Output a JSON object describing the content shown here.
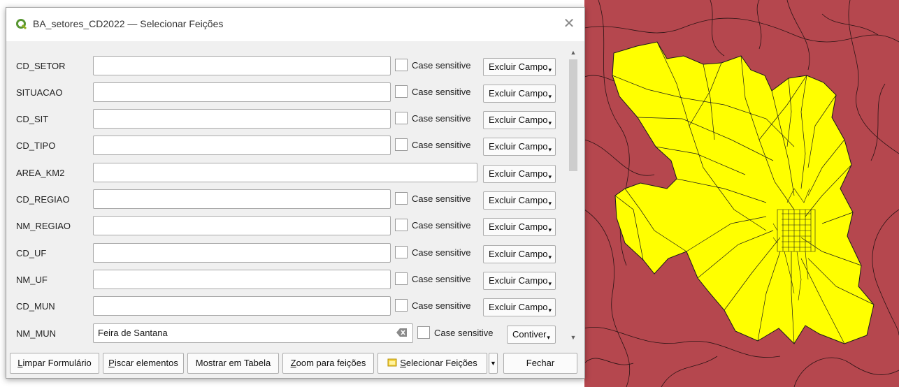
{
  "window": {
    "title": "BA_setores_CD2022 — Selecionar Feições",
    "close_glyph": "✕"
  },
  "fields": [
    {
      "label": "CD_SETOR",
      "value": "",
      "case_sensitive": true,
      "operator": "Excluir Campo"
    },
    {
      "label": "SITUACAO",
      "value": "",
      "case_sensitive": true,
      "operator": "Excluir Campo"
    },
    {
      "label": "CD_SIT",
      "value": "",
      "case_sensitive": true,
      "operator": "Excluir Campo"
    },
    {
      "label": "CD_TIPO",
      "value": "",
      "case_sensitive": true,
      "operator": "Excluir Campo"
    },
    {
      "label": "AREA_KM2",
      "value": "",
      "case_sensitive": false,
      "operator": "Excluir Campo"
    },
    {
      "label": "CD_REGIAO",
      "value": "",
      "case_sensitive": true,
      "operator": "Excluir Campo"
    },
    {
      "label": "NM_REGIAO",
      "value": "",
      "case_sensitive": true,
      "operator": "Excluir Campo"
    },
    {
      "label": "CD_UF",
      "value": "",
      "case_sensitive": true,
      "operator": "Excluir Campo"
    },
    {
      "label": "NM_UF",
      "value": "",
      "case_sensitive": true,
      "operator": "Excluir Campo"
    },
    {
      "label": "CD_MUN",
      "value": "",
      "case_sensitive": true,
      "operator": "Excluir Campo"
    },
    {
      "label": "NM_MUN",
      "value": "Feira de Santana",
      "case_sensitive": true,
      "operator": "Contiver"
    }
  ],
  "case_sensitive_label": "Case sensitive",
  "buttons": {
    "clear_form": {
      "underline": "L",
      "rest": "impar Formulário"
    },
    "flash": {
      "underline": "P",
      "rest": "iscar elementos"
    },
    "show_table": "Mostrar em Tabela",
    "zoom": {
      "underline": "Z",
      "rest": "oom para feições"
    },
    "select": {
      "underline": "S",
      "rest": "elecionar Feições"
    },
    "close": "Fechar"
  },
  "icons": {
    "app": "qgis-logo-icon",
    "close": "close-icon",
    "clear": "clear-text-icon",
    "select": "select-features-icon",
    "dropdown": "chevron-down-icon"
  },
  "colors": {
    "map_background": "#b5474e",
    "selected_features": "#ffff00",
    "boundaries": "#1a1a1a",
    "dialog_bg": "#f0f0f0"
  }
}
